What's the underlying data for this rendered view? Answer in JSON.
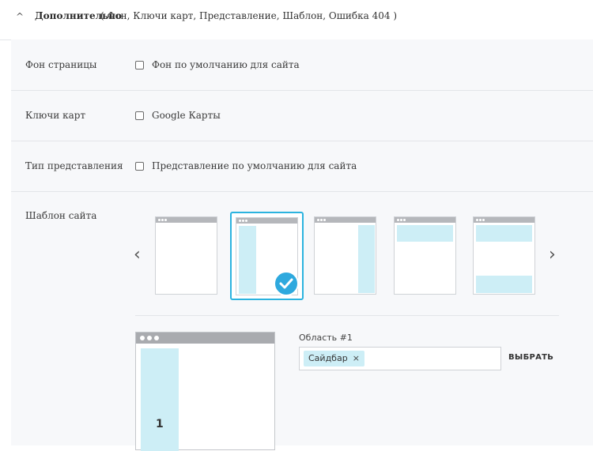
{
  "header": {
    "chevron": "^",
    "title": "Дополнительно",
    "subtitle": "( Фон,  Ключи карт,  Представление,  Шаблон,  Ошибка 404 )"
  },
  "rows": {
    "background": {
      "label": "Фон страницы",
      "checkbox_label": "Фон по умолчанию для сайта",
      "checked": false
    },
    "map_keys": {
      "label": "Ключи карт",
      "checkbox_label": "Google Карты",
      "checked": false
    },
    "view_type": {
      "label": "Тип представления",
      "checkbox_label": "Представление по умолчанию для сайта",
      "checked": false
    },
    "template": {
      "label": "Шаблон сайта"
    }
  },
  "carousel": {
    "prev_icon": "‹",
    "next_icon": "›",
    "templates": [
      "blank",
      "left-sidebar",
      "right-sidebar",
      "top-area",
      "top-bottom-areas"
    ],
    "selected": "left-sidebar"
  },
  "preview": {
    "area_number": "1"
  },
  "area": {
    "label": "Область #1",
    "tag": "Сайдбар",
    "remove_icon": "×",
    "choose_button": "ВЫБРАТЬ"
  },
  "colors": {
    "accent": "#2bb3df",
    "highlight_block": "#cdeef6",
    "panel_bg": "#f7f8fa"
  }
}
